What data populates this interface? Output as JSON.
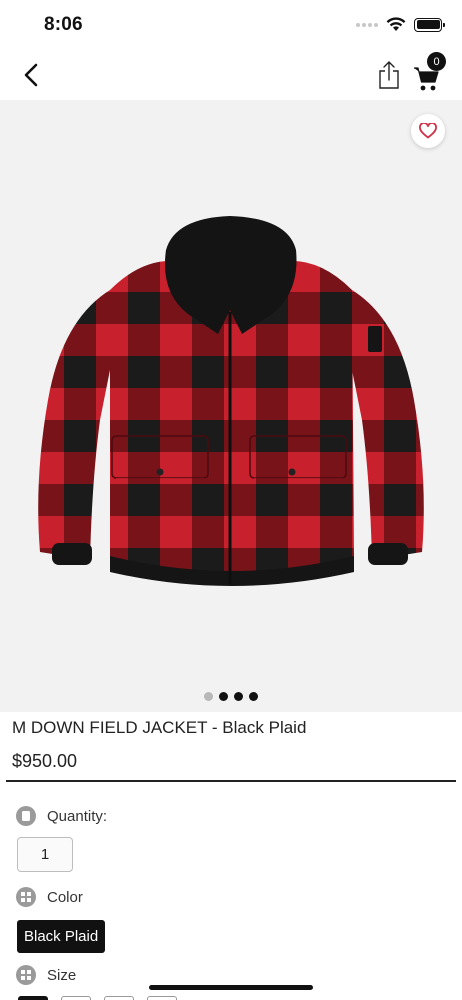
{
  "status_bar": {
    "time": "8:06",
    "icons": [
      "cellular-dots-icon",
      "wifi-icon",
      "battery-icon"
    ]
  },
  "nav": {
    "back_icon": "chevron-left-icon",
    "share_icon": "share-icon",
    "cart_icon": "cart-icon",
    "cart_count": "0"
  },
  "product": {
    "image_subject": "red and black buffalo plaid jacket with black shearling collar",
    "title": "M DOWN FIELD JACKET - Black Plaid",
    "price": "$950.00",
    "favorite_icon": "heart-outline-icon",
    "image_count": 4,
    "current_image_index": 1
  },
  "options": {
    "quantity": {
      "label": "Quantity:",
      "value": "1",
      "icon": "quantity-icon"
    },
    "color": {
      "label": "Color",
      "selected": "Black Plaid",
      "icon": "grid-icon"
    },
    "size": {
      "label": "Size",
      "icon": "grid-icon"
    }
  },
  "colors": {
    "accent": "#111111",
    "favorite": "#d0344a",
    "plaid_red": "#c8202c",
    "plaid_black": "#1a1a1a",
    "image_bg": "#f2f2f2"
  }
}
